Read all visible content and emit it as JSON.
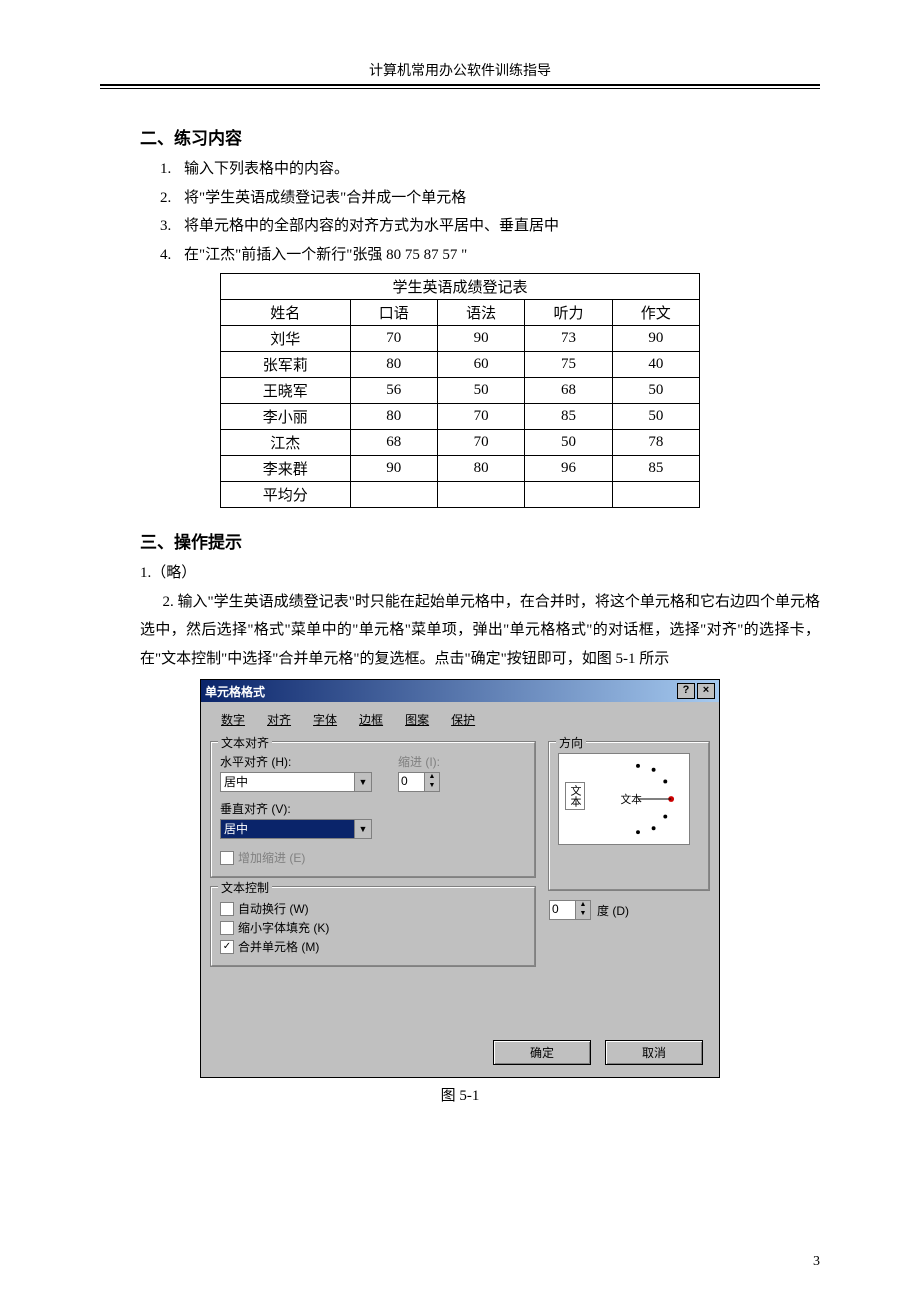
{
  "header": {
    "title": "计算机常用办公软件训练指导"
  },
  "section2": {
    "heading": "二、练习内容",
    "items": [
      {
        "num": "1.",
        "text": "输入下列表格中的内容。"
      },
      {
        "num": "2.",
        "text": "将\"学生英语成绩登记表\"合并成一个单元格"
      },
      {
        "num": "3.",
        "text": "将单元格中的全部内容的对齐方式为水平居中、垂直居中"
      },
      {
        "num": "4.",
        "text": "在\"江杰\"前插入一个新行\"张强  80   75   87   57   \""
      }
    ]
  },
  "grades": {
    "title": "学生英语成绩登记表",
    "headers": [
      "姓名",
      "口语",
      "语法",
      "听力",
      "作文"
    ],
    "rows": [
      [
        "刘华",
        "70",
        "90",
        "73",
        "90"
      ],
      [
        "张军莉",
        "80",
        "60",
        "75",
        "40"
      ],
      [
        "王晓军",
        "56",
        "50",
        "68",
        "50"
      ],
      [
        "李小丽",
        "80",
        "70",
        "85",
        "50"
      ],
      [
        "江杰",
        "68",
        "70",
        "50",
        "78"
      ],
      [
        "李来群",
        "90",
        "80",
        "96",
        "85"
      ],
      [
        "平均分",
        "",
        "",
        "",
        ""
      ]
    ]
  },
  "section3": {
    "heading": "三、操作提示",
    "item1": "1.（略）",
    "item2": "2. 输入\"学生英语成绩登记表\"时只能在起始单元格中，在合并时，将这个单元格和它右边四个单元格选中，然后选择\"格式\"菜单中的\"单元格\"菜单项，弹出\"单元格格式\"的对话框，选择\"对齐\"的选择卡，在\"文本控制\"中选择\"合并单元格\"的复选框。点击\"确定\"按钮即可，如图 5-1 所示"
  },
  "dialog": {
    "title": "单元格格式",
    "help": "?",
    "close": "×",
    "tabs": [
      "数字",
      "对齐",
      "字体",
      "边框",
      "图案",
      "保护"
    ],
    "group_align": "文本对齐",
    "group_orient": "方向",
    "h_label": "水平对齐 (H):",
    "h_value": "居中",
    "indent_label": "缩进 (I):",
    "indent_value": "0",
    "v_label": "垂直对齐 (V):",
    "v_value": "居中",
    "add_indent": "增加缩进 (E)",
    "group_ctrl": "文本控制",
    "wrap": "自动换行 (W)",
    "shrink": "缩小字体填充 (K)",
    "merge": "合并单元格 (M)",
    "orient_text_v": "文本",
    "orient_text_h": "文本",
    "deg_value": "0",
    "deg_label": "度 (D)",
    "ok": "确定",
    "cancel": "取消"
  },
  "fig_caption": "图 5-1",
  "page_number": "3",
  "chart_data": {
    "type": "table",
    "title": "学生英语成绩登记表",
    "categories": [
      "姓名",
      "口语",
      "语法",
      "听力",
      "作文"
    ],
    "series": [
      {
        "name": "刘华",
        "values": [
          70,
          90,
          73,
          90
        ]
      },
      {
        "name": "张军莉",
        "values": [
          80,
          60,
          75,
          40
        ]
      },
      {
        "name": "王晓军",
        "values": [
          56,
          50,
          68,
          50
        ]
      },
      {
        "name": "李小丽",
        "values": [
          80,
          70,
          85,
          50
        ]
      },
      {
        "name": "江杰",
        "values": [
          68,
          70,
          50,
          78
        ]
      },
      {
        "name": "李来群",
        "values": [
          90,
          80,
          96,
          85
        ]
      },
      {
        "name": "平均分",
        "values": [
          null,
          null,
          null,
          null
        ]
      }
    ]
  }
}
